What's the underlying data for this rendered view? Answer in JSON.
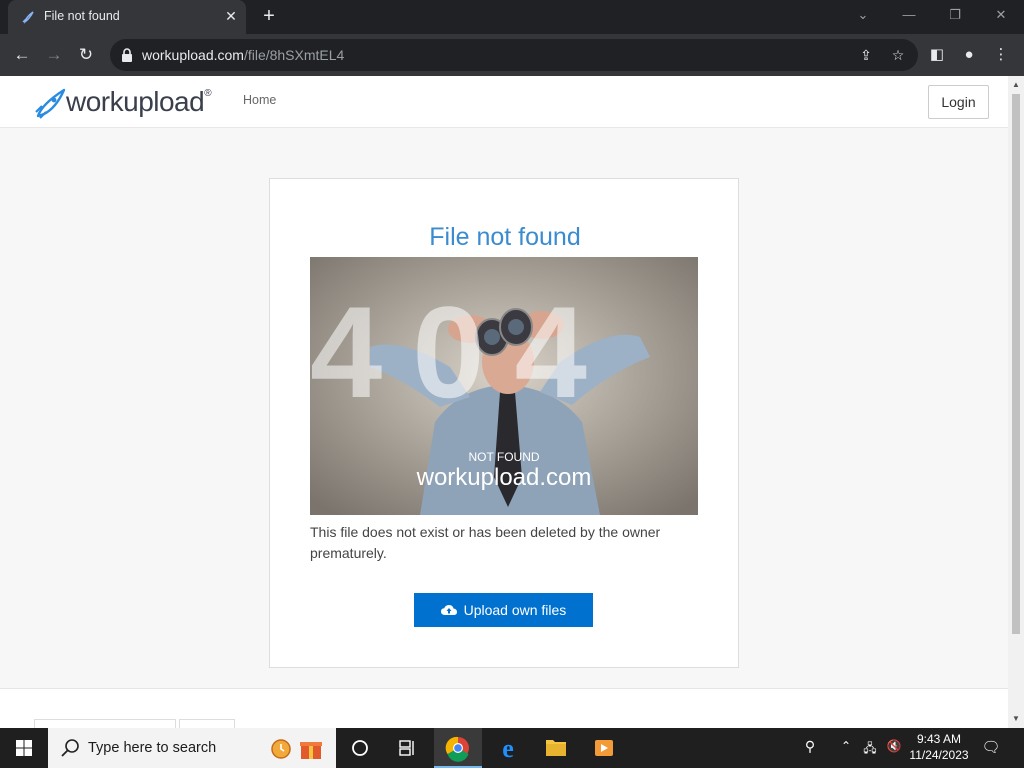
{
  "browser": {
    "tab_title": "File not found",
    "url_host": "workupload.com",
    "url_path": "/file/8hSXmtEL4"
  },
  "site": {
    "logo_text": "workupload",
    "logo_reg": "®",
    "nav_home": "Home",
    "login_label": "Login"
  },
  "card": {
    "title": "File not found",
    "image_overlay_big": "404",
    "image_overlay_small": "NOT FOUND",
    "image_overlay_brand": "workupload.com",
    "message": "This file does not exist or has been deleted by the owner prematurely.",
    "upload_button": "Upload own files"
  },
  "taskbar": {
    "search_placeholder": "Type here to search",
    "time": "9:43 AM",
    "date": "11/24/2023"
  },
  "colors": {
    "accent": "#3a8bd0",
    "button": "#0071ce"
  }
}
